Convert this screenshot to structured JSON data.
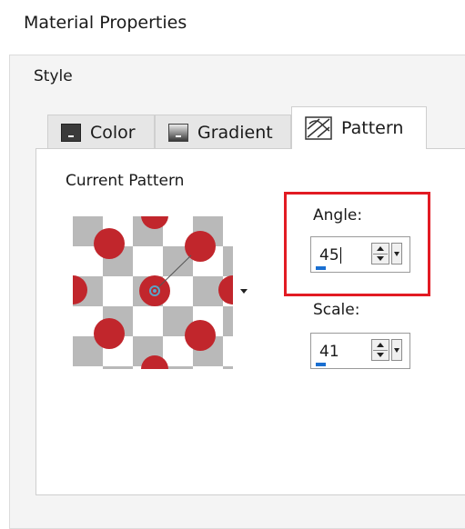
{
  "window": {
    "title": "Material Properties"
  },
  "style_group": {
    "label": "Style"
  },
  "tabs": [
    {
      "label": "Color",
      "icon": "color-swatch-icon",
      "active": false
    },
    {
      "label": "Gradient",
      "icon": "gradient-swatch-icon",
      "active": false
    },
    {
      "label": "Pattern",
      "icon": "pattern-icon",
      "active": true
    }
  ],
  "pattern_panel": {
    "current_pattern_label": "Current Pattern",
    "pattern_colors": {
      "dot": "#c1262c",
      "checker": "#b9b9b9",
      "background": "#ffffff"
    }
  },
  "angle": {
    "label": "Angle:",
    "value": "45"
  },
  "scale": {
    "label": "Scale:",
    "value": "41"
  },
  "colors": {
    "highlight": "#e21b23",
    "accent": "#1a6fd1"
  }
}
